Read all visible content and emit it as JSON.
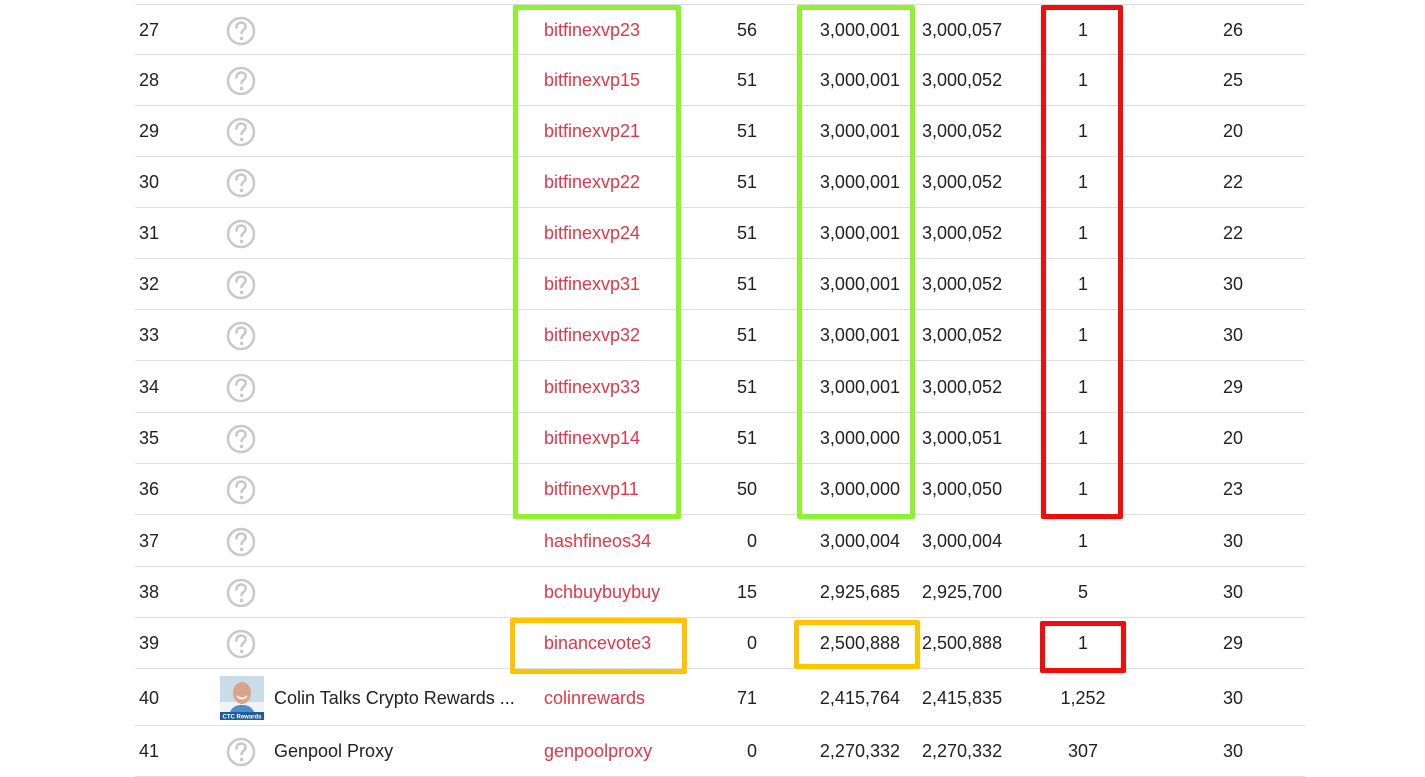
{
  "colors": {
    "account_link": "#e0384a",
    "highlight_green": "#8ef22f",
    "highlight_yellow": "#ffc400",
    "highlight_red": "#f20d0d",
    "row_divider": "#dddddd"
  },
  "rows": [
    {
      "rank": "27",
      "icon": "unknown-logo-icon",
      "label": "",
      "account": "bitfinexvp23",
      "col_a": "56",
      "col_b": "3,000,001",
      "col_c": "3,000,057",
      "col_d": "1",
      "col_e": "26"
    },
    {
      "rank": "28",
      "icon": "unknown-logo-icon",
      "label": "",
      "account": "bitfinexvp15",
      "col_a": "51",
      "col_b": "3,000,001",
      "col_c": "3,000,052",
      "col_d": "1",
      "col_e": "25"
    },
    {
      "rank": "29",
      "icon": "unknown-logo-icon",
      "label": "",
      "account": "bitfinexvp21",
      "col_a": "51",
      "col_b": "3,000,001",
      "col_c": "3,000,052",
      "col_d": "1",
      "col_e": "20"
    },
    {
      "rank": "30",
      "icon": "unknown-logo-icon",
      "label": "",
      "account": "bitfinexvp22",
      "col_a": "51",
      "col_b": "3,000,001",
      "col_c": "3,000,052",
      "col_d": "1",
      "col_e": "22"
    },
    {
      "rank": "31",
      "icon": "unknown-logo-icon",
      "label": "",
      "account": "bitfinexvp24",
      "col_a": "51",
      "col_b": "3,000,001",
      "col_c": "3,000,052",
      "col_d": "1",
      "col_e": "22"
    },
    {
      "rank": "32",
      "icon": "unknown-logo-icon",
      "label": "",
      "account": "bitfinexvp31",
      "col_a": "51",
      "col_b": "3,000,001",
      "col_c": "3,000,052",
      "col_d": "1",
      "col_e": "30"
    },
    {
      "rank": "33",
      "icon": "unknown-logo-icon",
      "label": "",
      "account": "bitfinexvp32",
      "col_a": "51",
      "col_b": "3,000,001",
      "col_c": "3,000,052",
      "col_d": "1",
      "col_e": "30"
    },
    {
      "rank": "34",
      "icon": "unknown-logo-icon",
      "label": "",
      "account": "bitfinexvp33",
      "col_a": "51",
      "col_b": "3,000,001",
      "col_c": "3,000,052",
      "col_d": "1",
      "col_e": "29"
    },
    {
      "rank": "35",
      "icon": "unknown-logo-icon",
      "label": "",
      "account": "bitfinexvp14",
      "col_a": "51",
      "col_b": "3,000,000",
      "col_c": "3,000,051",
      "col_d": "1",
      "col_e": "20"
    },
    {
      "rank": "36",
      "icon": "unknown-logo-icon",
      "label": "",
      "account": "bitfinexvp11",
      "col_a": "50",
      "col_b": "3,000,000",
      "col_c": "3,000,050",
      "col_d": "1",
      "col_e": "23"
    },
    {
      "rank": "37",
      "icon": "unknown-logo-icon",
      "label": "",
      "account": "hashfineos34",
      "col_a": "0",
      "col_b": "3,000,004",
      "col_c": "3,000,004",
      "col_d": "1",
      "col_e": "30"
    },
    {
      "rank": "38",
      "icon": "unknown-logo-icon",
      "label": "",
      "account": "bchbuybuybuy",
      "col_a": "15",
      "col_b": "2,925,685",
      "col_c": "2,925,700",
      "col_d": "5",
      "col_e": "30"
    },
    {
      "rank": "39",
      "icon": "unknown-logo-icon",
      "label": "",
      "account": "binancevote3",
      "col_a": "0",
      "col_b": "2,500,888",
      "col_c": "2,500,888",
      "col_d": "1",
      "col_e": "29"
    },
    {
      "rank": "40",
      "icon": "avatar-photo",
      "label": "Colin Talks Crypto Rewards ...",
      "logo_text": "CTC Rewards",
      "account": "colinrewards",
      "col_a": "71",
      "col_b": "2,415,764",
      "col_c": "2,415,835",
      "col_d": "1,252",
      "col_e": "30"
    },
    {
      "rank": "41",
      "icon": "unknown-logo-icon",
      "label": "Genpool Proxy",
      "account": "genpoolproxy",
      "col_a": "0",
      "col_b": "2,270,332",
      "col_c": "2,270,332",
      "col_d": "307",
      "col_e": "30"
    }
  ]
}
